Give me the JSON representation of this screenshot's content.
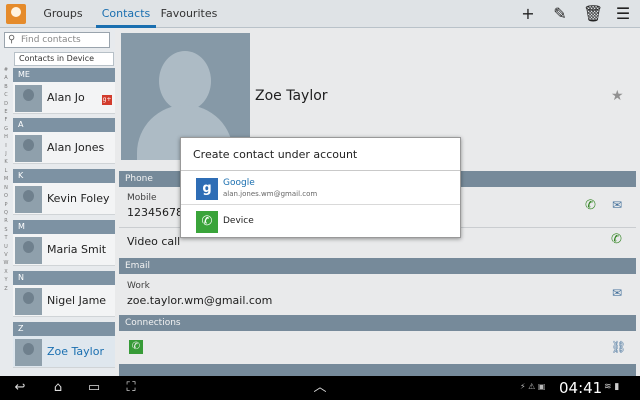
{
  "topbar": {
    "tabs": [
      {
        "label": "Groups",
        "active": false
      },
      {
        "label": "Contacts",
        "active": true
      },
      {
        "label": "Favourites",
        "active": false
      }
    ],
    "tools": [
      "add-icon",
      "edit-icon",
      "delete-icon",
      "menu-icon"
    ]
  },
  "sidebar": {
    "search_placeholder": "Find contacts",
    "source_label": "Contacts in Device",
    "alphabet": [
      "#",
      "A",
      "B",
      "C",
      "D",
      "E",
      "F",
      "G",
      "H",
      "I",
      "J",
      "K",
      "L",
      "M",
      "N",
      "O",
      "P",
      "Q",
      "R",
      "S",
      "T",
      "U",
      "V",
      "W",
      "X",
      "Y",
      "Z"
    ],
    "sections": [
      {
        "letter": "ME",
        "contacts": [
          {
            "name": "Alan Jo",
            "badge": "g+"
          }
        ]
      },
      {
        "letter": "A",
        "contacts": [
          {
            "name": "Alan Jones"
          }
        ]
      },
      {
        "letter": "K",
        "contacts": [
          {
            "name": "Kevin Foley"
          }
        ]
      },
      {
        "letter": "M",
        "contacts": [
          {
            "name": "Maria Smit"
          }
        ]
      },
      {
        "letter": "N",
        "contacts": [
          {
            "name": "Nigel Jame"
          }
        ]
      },
      {
        "letter": "Z",
        "contacts": [
          {
            "name": "Zoe Taylor",
            "selected": true
          }
        ]
      }
    ]
  },
  "detail": {
    "name": "Zoe Taylor",
    "phone_header": "Phone",
    "mobile_label": "Mobile",
    "mobile_value": "1234567890",
    "video_call_label": "Video call",
    "email_header": "Email",
    "work_label": "Work",
    "email_value": "zoe.taylor.wm@gmail.com",
    "connections_header": "Connections"
  },
  "dialog": {
    "title": "Create contact under account",
    "options": [
      {
        "label": "Google",
        "sublabel": "alan.jones.wm@gmail.com"
      },
      {
        "label": "Device"
      }
    ]
  },
  "statusbar": {
    "time": "04:41"
  },
  "colors": {
    "accent": "#1a6fb0",
    "section_header": "#7d92a3",
    "call_green": "#3a8f2a"
  }
}
